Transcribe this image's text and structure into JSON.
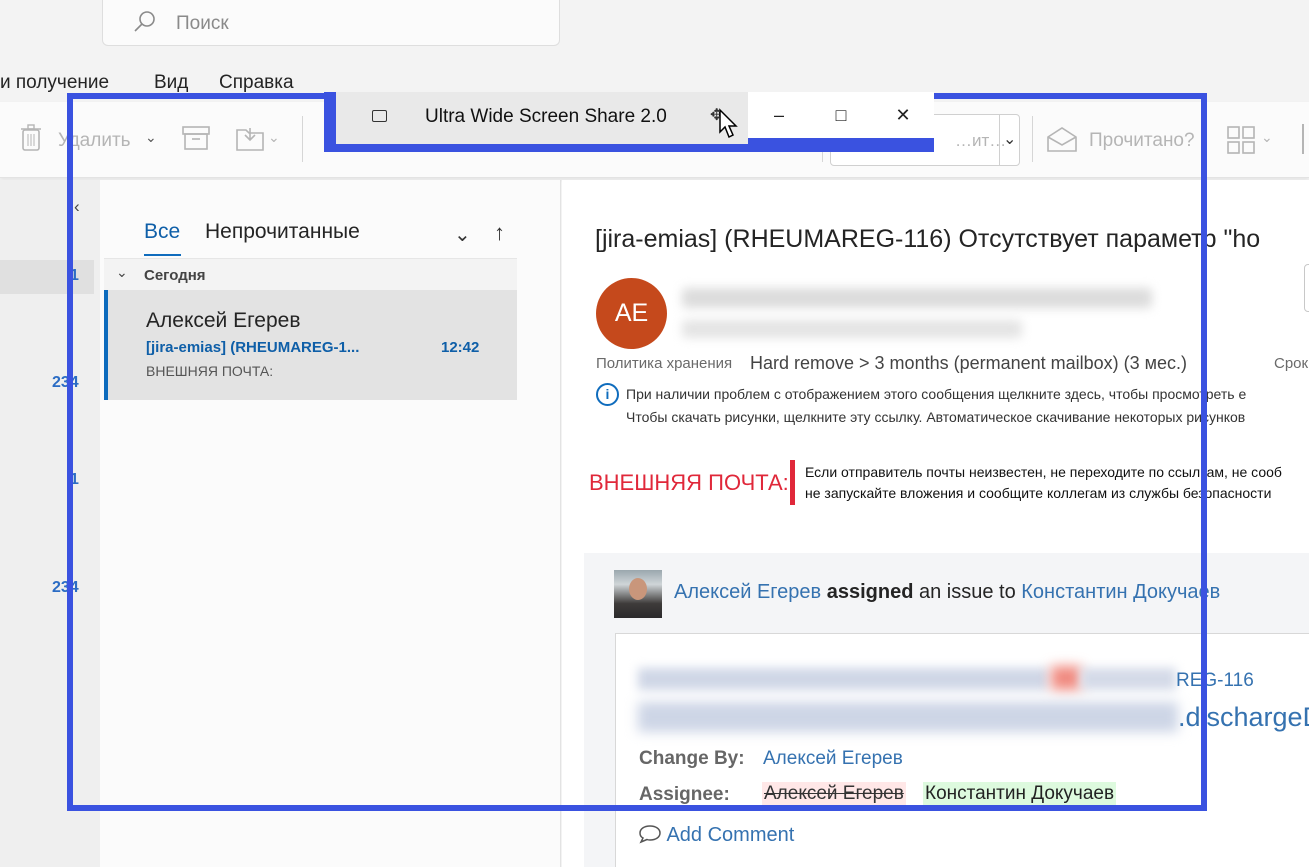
{
  "search": {
    "placeholder": "Поиск"
  },
  "menu": {
    "items": [
      "и получение",
      "Вид",
      "Справка"
    ]
  },
  "ribbon": {
    "delete_label": "Удалить",
    "read_label": "Прочитано?",
    "dropdown_text": "…ит…"
  },
  "nav": {
    "counts": [
      "1",
      "234",
      "1",
      "234"
    ]
  },
  "mail_list": {
    "tabs": [
      "Все",
      "Непрочитанные"
    ],
    "group": "Сегодня",
    "message": {
      "sender": "Алексей Егерев",
      "subject": "[jira-emias] (RHEUMAREG-1...",
      "time": "12:42",
      "preview": "ВНЕШНЯЯ ПОЧТА:"
    }
  },
  "reading": {
    "title": "[jira-emias] (RHEUMAREG-116) Отсутствует параметр \"ho",
    "avatar_initials": "AE",
    "retention_label": "Политика хранения",
    "retention_value": "Hard remove > 3 months (permanent mailbox) (3 мес.)",
    "retention_expiry": "Срок",
    "info_line1": "При наличии проблем с отображением этого сообщения щелкните здесь, чтобы просмотреть е",
    "info_line2": "Чтобы скачать рисунки, щелкните эту ссылку. Автоматическое скачивание некоторых рисунков",
    "external_label": "ВНЕШНЯЯ ПОЧТА:",
    "external_line1": "Если отправитель почты неизвестен, не переходите по ссылкам, не сооб",
    "external_line2": "не запускайте вложения и сообщите коллегам из службы безопасности",
    "jira": {
      "actor": "Алексей Егерев",
      "action": "assigned",
      "middle": "an issue to",
      "target": "Константин Докучаев",
      "issue_key_tail": "REG-116",
      "summary_tail": ".dischargeD",
      "change_by_label": "Change By:",
      "change_by_value": "Алексей Егерев",
      "assignee_label": "Assignee:",
      "assignee_old": "Алексей Егерев",
      "assignee_new": "Константин Докучаев",
      "add_comment": "Add Comment"
    }
  },
  "share_window": {
    "title": "Ultra Wide Screen Share 2.0",
    "frame_color": "#3a52e0"
  }
}
